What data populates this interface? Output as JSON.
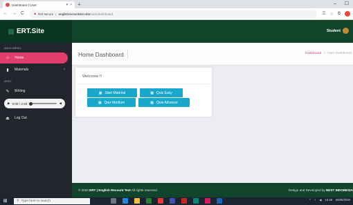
{
  "browser": {
    "tab_title": "Dashboard | User",
    "tab_menu": "▾",
    "tab_close": "×",
    "new_tab": "+",
    "minimize": "–",
    "maximize": "☐",
    "back": "←",
    "forward": "→",
    "reload": "C",
    "security_icon": "▲",
    "security_text": "Not secure",
    "separator": "|",
    "url_host": "englishrecounttext.site",
    "url_path": "/user/dashboard"
  },
  "header": {
    "brand": "ERT.Site",
    "user_name": "Student"
  },
  "sidebar": {
    "main_menu_heading": "MAIN MENU",
    "misc_heading": "MISC",
    "items": [
      {
        "label": "Home",
        "icon": "home-icon",
        "glyph": "⌂",
        "active": true
      },
      {
        "label": "Materials",
        "icon": "book-icon",
        "glyph": "▮",
        "chevron": "›"
      },
      {
        "label": "Writing",
        "icon": "pen-icon",
        "glyph": "✎"
      },
      {
        "label": "Log Out",
        "icon": "logout-icon",
        "glyph": "⏏"
      }
    ],
    "audio": {
      "time": "0:00 / 2:40",
      "play_glyph": "▶",
      "volume_glyph": "◀",
      "progress": 0
    }
  },
  "main": {
    "page_title": "Home Dashboard",
    "breadcrumb": [
      "Dashboard",
      "User Dashboard"
    ],
    "breadcrumb_sep": ">",
    "welcome": "Welcome !!",
    "buttons": [
      {
        "label": "Start Material"
      },
      {
        "label": "Quiz Easy"
      },
      {
        "label": "Quiz Medium"
      },
      {
        "label": "Quiz Advance"
      }
    ],
    "button_icon": "▦"
  },
  "footer": {
    "copyright_prefix": "© 2020",
    "copyright_brand": "ERT | English Recount Text",
    "copyright_suffix": "All rights reserved.",
    "credit_prefix": "Design and Developed by",
    "credit_name": "NEST INDONESIA"
  },
  "taskbar": {
    "search_placeholder": "Type here to search",
    "time": "13:48",
    "date": "06/08/2020"
  },
  "colors": {
    "header_green": "#10452c",
    "sidebar_dark": "#22252c",
    "active_pink": "#e23e6b",
    "button_cyan": "#19a8cc"
  }
}
